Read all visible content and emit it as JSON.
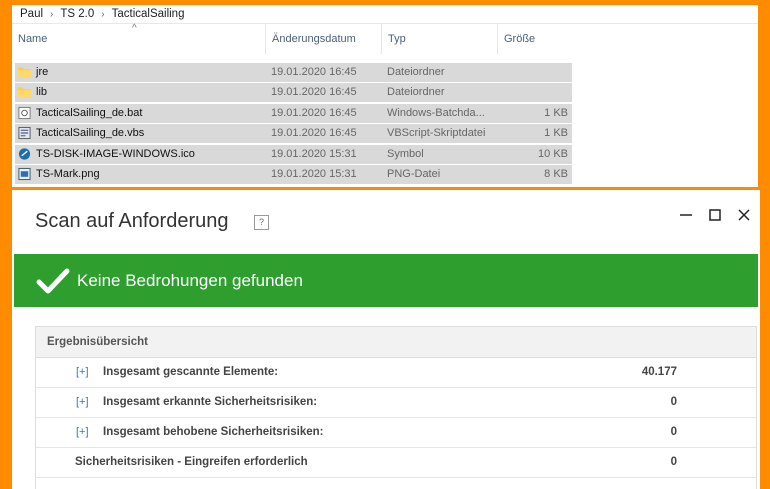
{
  "explorer": {
    "breadcrumb": [
      "Paul",
      "TS 2.0",
      "TacticalSailing"
    ],
    "columns": {
      "name": "Name",
      "date": "Änderungsdatum",
      "type": "Typ",
      "size": "Größe"
    },
    "files": [
      {
        "name": "jre",
        "date": "19.01.2020 16:45",
        "type": "Dateiordner",
        "size": "",
        "icon": "folder-icon"
      },
      {
        "name": "lib",
        "date": "19.01.2020 16:45",
        "type": "Dateiordner",
        "size": "",
        "icon": "folder-icon"
      },
      {
        "name": "TacticalSailing_de.bat",
        "date": "19.01.2020 16:45",
        "type": "Windows-Batchda...",
        "size": "1 KB",
        "icon": "batch-file-icon"
      },
      {
        "name": "TacticalSailing_de.vbs",
        "date": "19.01.2020 16:45",
        "type": "VBScript-Skriptdatei",
        "size": "1 KB",
        "icon": "script-file-icon"
      },
      {
        "name": "TS-DISK-IMAGE-WINDOWS.ico",
        "date": "19.01.2020 15:31",
        "type": "Symbol",
        "size": "10 KB",
        "icon": "ico-file-icon"
      },
      {
        "name": "TS-Mark.png",
        "date": "19.01.2020 15:31",
        "type": "PNG-Datei",
        "size": "8 KB",
        "icon": "image-file-icon"
      }
    ]
  },
  "scan": {
    "title": "Scan auf Anforderung",
    "help": "?",
    "status": "Keine Bedrohungen gefunden",
    "status_color": "#2e9f2e",
    "summary_header": "Ergebnisübersicht",
    "rows": [
      {
        "expander": "[+]",
        "label": "Insgesamt gescannte Elemente:",
        "value": "40.177"
      },
      {
        "expander": "[+]",
        "label": "Insgesamt erkannte Sicherheitsrisiken:",
        "value": "0"
      },
      {
        "expander": "[+]",
        "label": "Insgesamt behobene Sicherheitsrisiken:",
        "value": "0"
      },
      {
        "expander": "",
        "label": "Sicherheitsrisiken - Eingreifen erforderlich",
        "value": "0"
      }
    ]
  },
  "colors": {
    "frame": "#ff8c00",
    "selection": "#d9d9d9",
    "link": "#2f7ac2"
  }
}
